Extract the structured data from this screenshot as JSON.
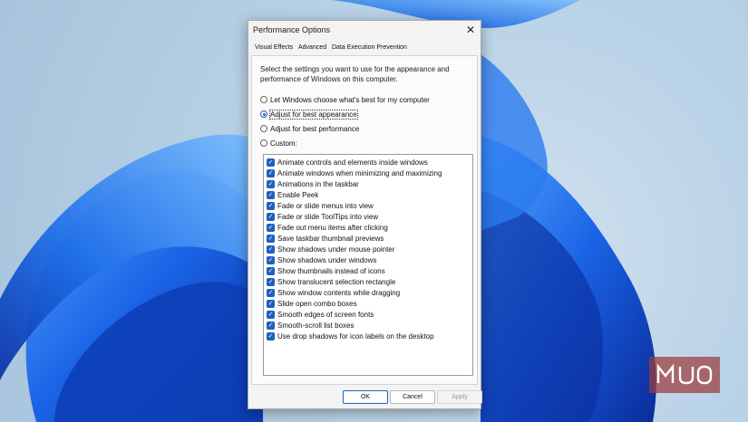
{
  "window": {
    "title": "Performance Options"
  },
  "tabs": [
    {
      "label": "Visual Effects",
      "active": true
    },
    {
      "label": "Advanced",
      "active": false
    },
    {
      "label": "Data Execution Prevention",
      "active": false
    }
  ],
  "description": "Select the settings you want to use for the appearance and performance of Windows on this computer.",
  "radios": [
    {
      "label": "Let Windows choose what's best for my computer",
      "selected": false
    },
    {
      "label": "Adjust for best appearance",
      "selected": true
    },
    {
      "label": "Adjust for best performance",
      "selected": false
    },
    {
      "label": "Custom:",
      "selected": false
    }
  ],
  "options": [
    {
      "label": "Animate controls and elements inside windows",
      "checked": true
    },
    {
      "label": "Animate windows when minimizing and maximizing",
      "checked": true
    },
    {
      "label": "Animations in the taskbar",
      "checked": true
    },
    {
      "label": "Enable Peek",
      "checked": true
    },
    {
      "label": "Fade or slide menus into view",
      "checked": true
    },
    {
      "label": "Fade or slide ToolTips into view",
      "checked": true
    },
    {
      "label": "Fade out menu items after clicking",
      "checked": true
    },
    {
      "label": "Save taskbar thumbnail previews",
      "checked": true
    },
    {
      "label": "Show shadows under mouse pointer",
      "checked": true
    },
    {
      "label": "Show shadows under windows",
      "checked": true
    },
    {
      "label": "Show thumbnails instead of icons",
      "checked": true
    },
    {
      "label": "Show translucent selection rectangle",
      "checked": true
    },
    {
      "label": "Show window contents while dragging",
      "checked": true
    },
    {
      "label": "Slide open combo boxes",
      "checked": true
    },
    {
      "label": "Smooth edges of screen fonts",
      "checked": true
    },
    {
      "label": "Smooth-scroll list boxes",
      "checked": true
    },
    {
      "label": "Use drop shadows for icon labels on the desktop",
      "checked": true
    }
  ],
  "buttons": {
    "ok": "OK",
    "cancel": "Cancel",
    "apply": "Apply"
  },
  "close_glyph": "✕",
  "check_glyph": "✓",
  "watermark": "MUO",
  "colors": {
    "accent": "#1f5fbf",
    "wallpaper_blue": "#1565e6"
  }
}
